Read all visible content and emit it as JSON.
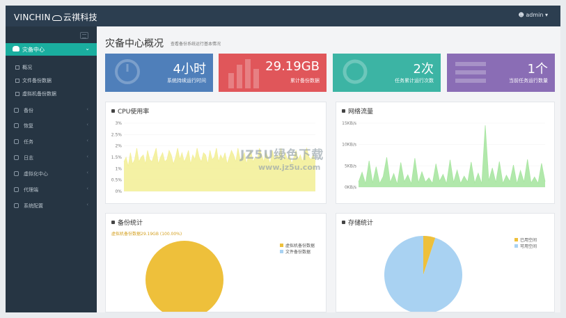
{
  "header": {
    "brand_left": "VINCHIN",
    "brand_right": "云祺科技",
    "user": "admin"
  },
  "sidebar": {
    "active": {
      "label": "灾备中心"
    },
    "subitems": [
      {
        "label": "概况"
      },
      {
        "label": "文件备份数据"
      },
      {
        "label": "虚拟机备份数据"
      }
    ],
    "items": [
      {
        "label": "备份"
      },
      {
        "label": "恢复"
      },
      {
        "label": "任务"
      },
      {
        "label": "日志"
      },
      {
        "label": "虚拟化中心"
      },
      {
        "label": "代理端"
      },
      {
        "label": "系统配置"
      }
    ]
  },
  "page": {
    "title": "灾备中心概况",
    "subtitle": "查看备份系统运行基本情况"
  },
  "stats": [
    {
      "value": "4小时",
      "label": "系统持续运行时间",
      "color": "#4f7fba"
    },
    {
      "value": "29.19GB",
      "label": "累计备份数据",
      "color": "#e0565a"
    },
    {
      "value": "2次",
      "label": "任务累计运行次数",
      "color": "#3cb4a4"
    },
    {
      "value": "1个",
      "label": "当前任务运行数量",
      "color": "#8a6db5"
    }
  ],
  "panels": {
    "cpu": {
      "title": "CPU使用率"
    },
    "network": {
      "title": "网络流量"
    },
    "backup": {
      "title": "备份统计",
      "note": "虚拟机备份数据29.19GB (100.00%)"
    },
    "storage": {
      "title": "存储统计"
    }
  },
  "watermark": {
    "line1": "JZ5U绿色下载",
    "line2": "www.jz5u.com"
  },
  "chart_data": [
    {
      "type": "area",
      "title": "CPU使用率",
      "yticks": [
        "3%",
        "2.5%",
        "2%",
        "1.5%",
        "1%",
        "0.5%",
        "0%"
      ],
      "ylim": [
        0,
        3
      ],
      "values": [
        1.3,
        1.5,
        1.1,
        1.7,
        1.2,
        1.4,
        1.9,
        1.3,
        1.5,
        1.6,
        1.2,
        1.8,
        1.4,
        1.3,
        1.6,
        1.9,
        1.2,
        1.5,
        1.7,
        1.3,
        1.4,
        1.8,
        1.6,
        1.2,
        1.5,
        1.9,
        1.4,
        1.7,
        1.3,
        1.5,
        1.8,
        1.2,
        1.6,
        1.4,
        1.9,
        1.5,
        1.3,
        1.7,
        1.6,
        1.2,
        1.8,
        1.4,
        1.5,
        1.9,
        1.3,
        1.6,
        1.4,
        1.7,
        1.2,
        1.5,
        1.8,
        1.6,
        1.3,
        1.9,
        1.4,
        1.5,
        1.7,
        1.2,
        1.6,
        1.8,
        1.3,
        1.5,
        1.4,
        1.9,
        1.6,
        1.3,
        1.7,
        1.5,
        1.2,
        1.8,
        1.4,
        1.6,
        1.5,
        1.9,
        1.3,
        1.7,
        1.4,
        1.6,
        1.2,
        1.5,
        1.8,
        1.4,
        1.6,
        1.3,
        1.7,
        1.9,
        1.5,
        1.4,
        1.6,
        1.3
      ],
      "color": "#f3ef9a"
    },
    {
      "type": "area",
      "title": "网络流量",
      "yticks": [
        "15KB/s",
        "10KB/s",
        "5KB/s",
        "0KB/s"
      ],
      "ylim": [
        0,
        15
      ],
      "values": [
        1.2,
        3.5,
        0.8,
        6.2,
        1.0,
        4.8,
        0.9,
        2.5,
        7.0,
        1.1,
        3.2,
        0.7,
        5.8,
        1.3,
        2.9,
        0.8,
        6.8,
        1.0,
        3.6,
        1.2,
        2.2,
        0.9,
        5.5,
        1.4,
        3.0,
        0.8,
        6.4,
        1.1,
        4.0,
        0.9,
        2.6,
        1.2,
        5.9,
        1.0,
        3.3,
        0.8,
        14.5,
        1.5,
        4.5,
        1.1,
        6.0,
        0.9,
        2.8,
        1.3,
        5.2,
        0.8,
        3.9,
        1.2,
        6.5,
        1.0,
        2.4,
        0.9,
        5.6,
        1.3
      ],
      "color": "#a9e6a2"
    },
    {
      "type": "pie",
      "title": "备份统计",
      "series": [
        {
          "name": "虚拟机备份数据",
          "value": 100.0,
          "color": "#eec03b"
        },
        {
          "name": "文件备份数据",
          "value": 0.0,
          "color": "#a9d2f2"
        }
      ]
    },
    {
      "type": "pie",
      "title": "存储统计",
      "series": [
        {
          "name": "已用空间",
          "value": 5,
          "color": "#eec03b"
        },
        {
          "name": "可用空间",
          "value": 95,
          "color": "#a9d2f2"
        }
      ]
    }
  ]
}
